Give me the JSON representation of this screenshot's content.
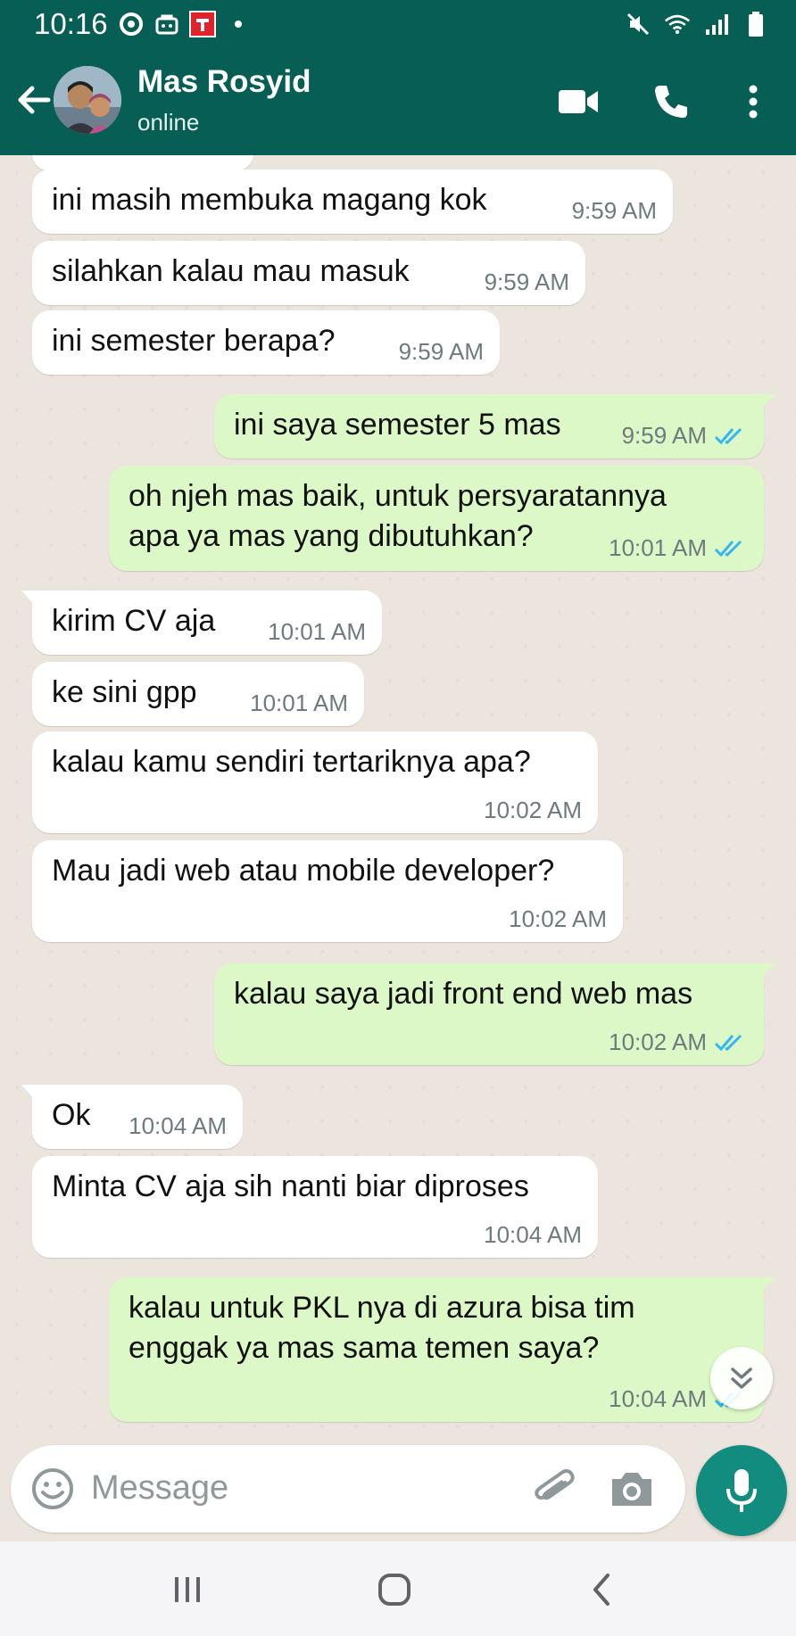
{
  "status_bar": {
    "time": "10:16"
  },
  "header": {
    "contact_name": "Mas Rosyid",
    "contact_status": "online"
  },
  "colors": {
    "header": "#075e54",
    "outgoing_bubble": "#dcf8c6",
    "incoming_bubble": "#ffffff",
    "accent": "#128c7e",
    "read_ticks": "#34b7f1"
  },
  "messages": [
    {
      "dir": "in",
      "text": "ini masih membuka magang kok",
      "time": "9:59 AM"
    },
    {
      "dir": "in",
      "text": "silahkan kalau mau masuk",
      "time": "9:59 AM"
    },
    {
      "dir": "in",
      "text": "ini semester berapa?",
      "time": "9:59 AM"
    },
    {
      "dir": "out",
      "text": "ini saya semester 5 mas",
      "time": "9:59 AM",
      "status": "read"
    },
    {
      "dir": "out",
      "text": "oh njeh mas baik, untuk persyaratannya\napa ya mas yang dibutuhkan?",
      "time": "10:01 AM",
      "status": "read"
    },
    {
      "dir": "in",
      "text": "kirim CV aja",
      "time": "10:01 AM"
    },
    {
      "dir": "in",
      "text": "ke sini gpp",
      "time": "10:01 AM"
    },
    {
      "dir": "in",
      "text": "kalau kamu sendiri tertariknya apa?",
      "time": "10:02 AM"
    },
    {
      "dir": "in",
      "text": "Mau jadi web atau mobile developer?",
      "time": "10:02 AM"
    },
    {
      "dir": "out",
      "text": "kalau saya jadi front end web mas",
      "time": "10:02 AM",
      "status": "read"
    },
    {
      "dir": "in",
      "text": "Ok",
      "time": "10:04 AM"
    },
    {
      "dir": "in",
      "text": "Minta CV aja sih nanti biar diproses",
      "time": "10:04 AM"
    },
    {
      "dir": "out",
      "text": "kalau untuk PKL nya di azura bisa tim\nenggak ya mas sama temen saya?",
      "time": "10:04 AM",
      "status": "read"
    }
  ],
  "composer": {
    "placeholder": "Message"
  },
  "icons": {
    "back": "arrow-left-icon",
    "video": "video-call-icon",
    "call": "phone-icon",
    "menu": "more-vert-icon",
    "emoji": "emoji-icon",
    "attach": "paperclip-icon",
    "camera": "camera-icon",
    "mic": "mic-icon",
    "scroll": "double-chevron-down-icon"
  }
}
